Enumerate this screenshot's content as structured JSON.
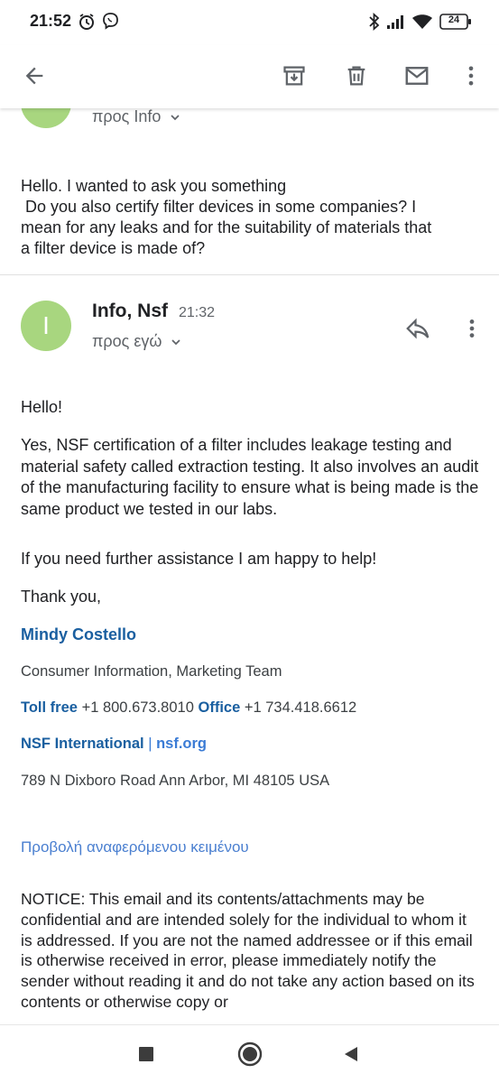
{
  "status": {
    "time": "21:52",
    "battery": "24"
  },
  "icons": {
    "back": "arrow-back-icon",
    "archive": "archive-icon",
    "delete": "trash-icon",
    "mark_unread": "mail-icon",
    "more": "more-vert-icon",
    "reply": "reply-icon"
  },
  "thread": {
    "first_message": {
      "recipient": "προς Info",
      "body": [
        "Hello. I wanted to ask you something",
        " Do you also certify filter devices in some companies? I",
        "mean for any leaks and for the suitability of materials that",
        "a filter device is made of?"
      ]
    },
    "second_message": {
      "avatar_letter": "I",
      "sender": "Info, Nsf",
      "time": "21:32",
      "recipient": "προς εγώ",
      "greeting": "Hello!",
      "paragraph1": "Yes, NSF certification of a filter includes leakage testing and material safety called extraction testing. It also involves an audit of the manufacturing facility to ensure what is being made is the same product we tested in our labs.",
      "paragraph2": "If you need further assistance I am happy to help!",
      "closing": "Thank you,",
      "signature": {
        "name": "Mindy Costello",
        "title": "Consumer Information, Marketing Team",
        "toll_free_label": "Toll free",
        "toll_free_number": "+1 800.673.8010",
        "office_label": "Office",
        "office_number": "+1 734.418.6612",
        "org": "NSF International",
        "separator": "|",
        "site": "nsf.org",
        "address": "789 N Dixboro Road Ann Arbor, MI 48105 USA"
      },
      "show_quoted": "Προβολή αναφερόμενου κειμένου",
      "notice": "NOTICE: This email and its contents/attachments may be confidential and are intended solely for the individual to whom it is addressed. If you are not the named addressee or if this email is otherwise received in error, please immediately notify the sender without reading it and do not take any action based on its contents or otherwise copy or"
    }
  },
  "colors": {
    "avatar": "#a8d67f",
    "signature_blue": "#1a5fa0",
    "link_blue": "#4a7fd0"
  }
}
